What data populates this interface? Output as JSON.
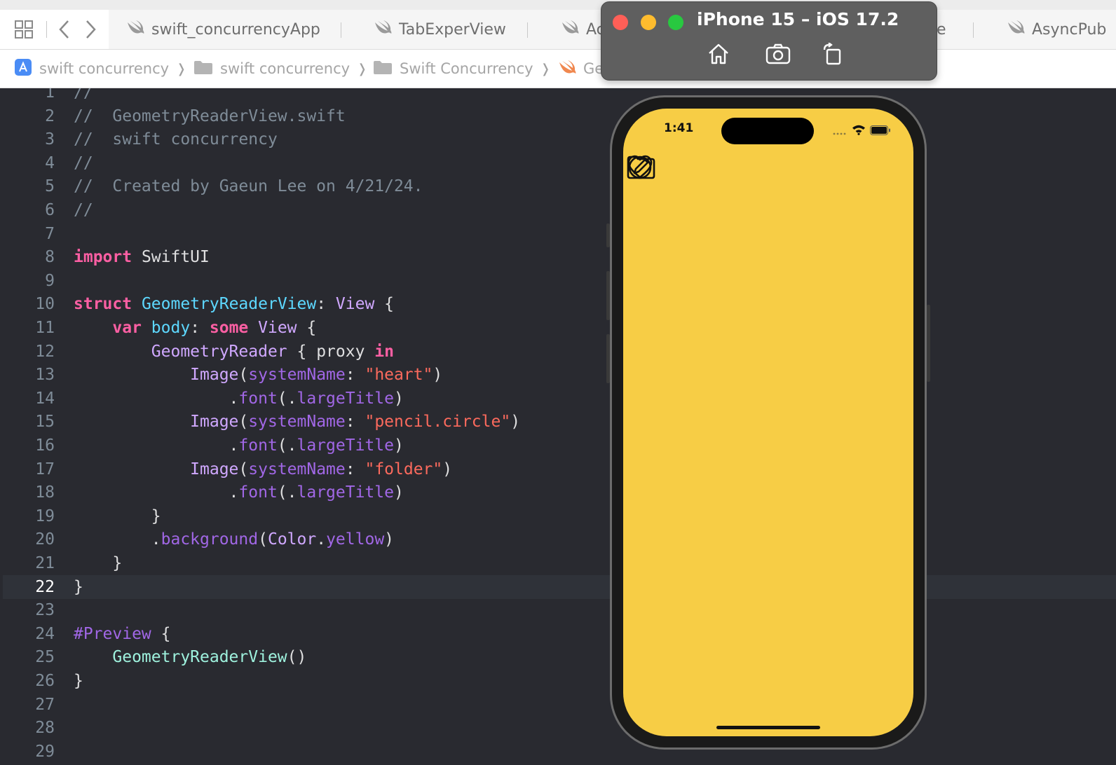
{
  "tabs": [
    {
      "label": "swift_concurrencyApp"
    },
    {
      "label": "TabExperView"
    },
    {
      "label": "Ac"
    },
    {
      "label": "e"
    },
    {
      "label": "AsyncPub"
    }
  ],
  "breadcrumbs": [
    {
      "label": "swift concurrency",
      "icon": "app-icon"
    },
    {
      "label": "swift concurrency",
      "icon": "folder-icon"
    },
    {
      "label": "Swift Concurrency",
      "icon": "folder-icon"
    },
    {
      "label": "Ge",
      "icon": "swift-file-icon"
    }
  ],
  "simulator": {
    "title": "iPhone 15 – iOS 17.2",
    "tools": [
      "home-icon",
      "screenshot-icon",
      "rotate-icon"
    ]
  },
  "phone": {
    "time": "1:41",
    "background": "#f7cd45"
  },
  "editor": {
    "current_line": 22,
    "lines": [
      {
        "n": "1",
        "tokens": [
          {
            "c": "t-comment",
            "t": "//"
          }
        ]
      },
      {
        "n": "2",
        "tokens": [
          {
            "c": "t-comment",
            "t": "//  GeometryReaderView.swift"
          }
        ]
      },
      {
        "n": "3",
        "tokens": [
          {
            "c": "t-comment",
            "t": "//  swift concurrency"
          }
        ]
      },
      {
        "n": "4",
        "tokens": [
          {
            "c": "t-comment",
            "t": "//"
          }
        ]
      },
      {
        "n": "5",
        "tokens": [
          {
            "c": "t-comment",
            "t": "//  Created by Gaeun Lee on 4/21/24."
          }
        ]
      },
      {
        "n": "6",
        "tokens": [
          {
            "c": "t-comment",
            "t": "//"
          }
        ]
      },
      {
        "n": "7",
        "tokens": []
      },
      {
        "n": "8",
        "tokens": [
          {
            "c": "t-kw",
            "t": "import"
          },
          {
            "c": "t-plain",
            "t": " SwiftUI"
          }
        ]
      },
      {
        "n": "9",
        "tokens": []
      },
      {
        "n": "10",
        "tokens": [
          {
            "c": "t-kw",
            "t": "struct"
          },
          {
            "c": "t-plain",
            "t": " "
          },
          {
            "c": "t-decl",
            "t": "GeometryReaderView"
          },
          {
            "c": "t-plain",
            "t": ": "
          },
          {
            "c": "t-type",
            "t": "View"
          },
          {
            "c": "t-plain",
            "t": " {"
          }
        ]
      },
      {
        "n": "11",
        "tokens": [
          {
            "c": "t-plain",
            "t": "    "
          },
          {
            "c": "t-kw",
            "t": "var"
          },
          {
            "c": "t-plain",
            "t": " "
          },
          {
            "c": "t-decl",
            "t": "body"
          },
          {
            "c": "t-plain",
            "t": ": "
          },
          {
            "c": "t-kw",
            "t": "some"
          },
          {
            "c": "t-plain",
            "t": " "
          },
          {
            "c": "t-type",
            "t": "View"
          },
          {
            "c": "t-plain",
            "t": " {"
          }
        ]
      },
      {
        "n": "12",
        "tokens": [
          {
            "c": "t-plain",
            "t": "        "
          },
          {
            "c": "t-type",
            "t": "GeometryReader"
          },
          {
            "c": "t-plain",
            "t": " { proxy "
          },
          {
            "c": "t-kw",
            "t": "in"
          }
        ]
      },
      {
        "n": "13",
        "tokens": [
          {
            "c": "t-plain",
            "t": "            "
          },
          {
            "c": "t-type",
            "t": "Image"
          },
          {
            "c": "t-plain",
            "t": "("
          },
          {
            "c": "t-proj",
            "t": "systemName"
          },
          {
            "c": "t-plain",
            "t": ": "
          },
          {
            "c": "t-str",
            "t": "\"heart\""
          },
          {
            "c": "t-plain",
            "t": ")"
          }
        ]
      },
      {
        "n": "14",
        "tokens": [
          {
            "c": "t-plain",
            "t": "                ."
          },
          {
            "c": "t-proj",
            "t": "font"
          },
          {
            "c": "t-plain",
            "t": "(."
          },
          {
            "c": "t-proj",
            "t": "largeTitle"
          },
          {
            "c": "t-plain",
            "t": ")"
          }
        ]
      },
      {
        "n": "15",
        "tokens": [
          {
            "c": "t-plain",
            "t": "            "
          },
          {
            "c": "t-type",
            "t": "Image"
          },
          {
            "c": "t-plain",
            "t": "("
          },
          {
            "c": "t-proj",
            "t": "systemName"
          },
          {
            "c": "t-plain",
            "t": ": "
          },
          {
            "c": "t-str",
            "t": "\"pencil.circle\""
          },
          {
            "c": "t-plain",
            "t": ")"
          }
        ]
      },
      {
        "n": "16",
        "tokens": [
          {
            "c": "t-plain",
            "t": "                ."
          },
          {
            "c": "t-proj",
            "t": "font"
          },
          {
            "c": "t-plain",
            "t": "(."
          },
          {
            "c": "t-proj",
            "t": "largeTitle"
          },
          {
            "c": "t-plain",
            "t": ")"
          }
        ]
      },
      {
        "n": "17",
        "tokens": [
          {
            "c": "t-plain",
            "t": "            "
          },
          {
            "c": "t-type",
            "t": "Image"
          },
          {
            "c": "t-plain",
            "t": "("
          },
          {
            "c": "t-proj",
            "t": "systemName"
          },
          {
            "c": "t-plain",
            "t": ": "
          },
          {
            "c": "t-str",
            "t": "\"folder\""
          },
          {
            "c": "t-plain",
            "t": ")"
          }
        ]
      },
      {
        "n": "18",
        "tokens": [
          {
            "c": "t-plain",
            "t": "                ."
          },
          {
            "c": "t-proj",
            "t": "font"
          },
          {
            "c": "t-plain",
            "t": "(."
          },
          {
            "c": "t-proj",
            "t": "largeTitle"
          },
          {
            "c": "t-plain",
            "t": ")"
          }
        ]
      },
      {
        "n": "19",
        "tokens": [
          {
            "c": "t-plain",
            "t": "        }"
          }
        ]
      },
      {
        "n": "20",
        "tokens": [
          {
            "c": "t-plain",
            "t": "        ."
          },
          {
            "c": "t-proj",
            "t": "background"
          },
          {
            "c": "t-plain",
            "t": "("
          },
          {
            "c": "t-type",
            "t": "Color"
          },
          {
            "c": "t-plain",
            "t": "."
          },
          {
            "c": "t-proj",
            "t": "yellow"
          },
          {
            "c": "t-plain",
            "t": ")"
          }
        ]
      },
      {
        "n": "21",
        "tokens": [
          {
            "c": "t-plain",
            "t": "    }"
          }
        ]
      },
      {
        "n": "22",
        "tokens": [
          {
            "c": "t-plain",
            "t": "}"
          }
        ]
      },
      {
        "n": "23",
        "tokens": []
      },
      {
        "n": "24",
        "tokens": [
          {
            "c": "t-macro",
            "t": "#Preview"
          },
          {
            "c": "t-plain",
            "t": " {"
          }
        ]
      },
      {
        "n": "25",
        "tokens": [
          {
            "c": "t-plain",
            "t": "    "
          },
          {
            "c": "t-proj-type",
            "t": "GeometryReaderView"
          },
          {
            "c": "t-plain",
            "t": "()"
          }
        ]
      },
      {
        "n": "26",
        "tokens": [
          {
            "c": "t-plain",
            "t": "}"
          }
        ]
      },
      {
        "n": "27",
        "tokens": []
      },
      {
        "n": "28",
        "tokens": []
      },
      {
        "n": "29",
        "tokens": []
      }
    ]
  }
}
